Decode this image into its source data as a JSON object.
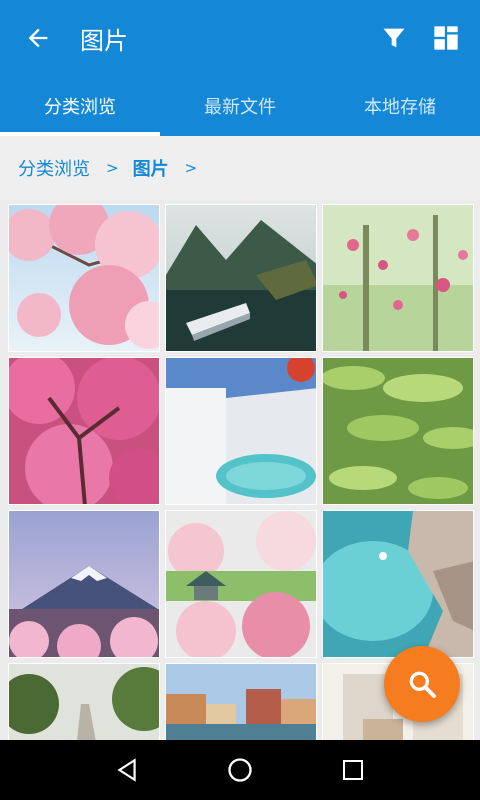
{
  "toolbar": {
    "title": "图片",
    "back_icon": "arrow-back-icon",
    "filter_icon": "filter-icon",
    "view_icon": "grid-view-icon"
  },
  "tabs": [
    {
      "label": "分类浏览",
      "active": true
    },
    {
      "label": "最新文件",
      "active": false
    },
    {
      "label": "本地存储",
      "active": false
    }
  ],
  "breadcrumb": {
    "items": [
      "分类浏览",
      "图片"
    ],
    "separator": ">"
  },
  "images": [
    {
      "subject": "cherry-blossom-branches-sky"
    },
    {
      "subject": "mountain-lake-boat"
    },
    {
      "subject": "pink-blossom-green-forest"
    },
    {
      "subject": "pink-cherry-tree"
    },
    {
      "subject": "white-terrace-pool"
    },
    {
      "subject": "lotus-leaves"
    },
    {
      "subject": "mount-fuji-blossoms"
    },
    {
      "subject": "blossom-garden-pavilion"
    },
    {
      "subject": "turquoise-sea-cove"
    },
    {
      "subject": "tree-lined-road"
    },
    {
      "subject": "venice-canal"
    },
    {
      "subject": "white-room-interior"
    }
  ],
  "fab": {
    "icon": "search-icon"
  },
  "navbar": {
    "icons": [
      "nav-back-icon",
      "nav-home-icon",
      "nav-recents-icon"
    ]
  },
  "colors": {
    "primary": "#1488d6",
    "accent": "#f57c1f",
    "background": "#ececec"
  }
}
